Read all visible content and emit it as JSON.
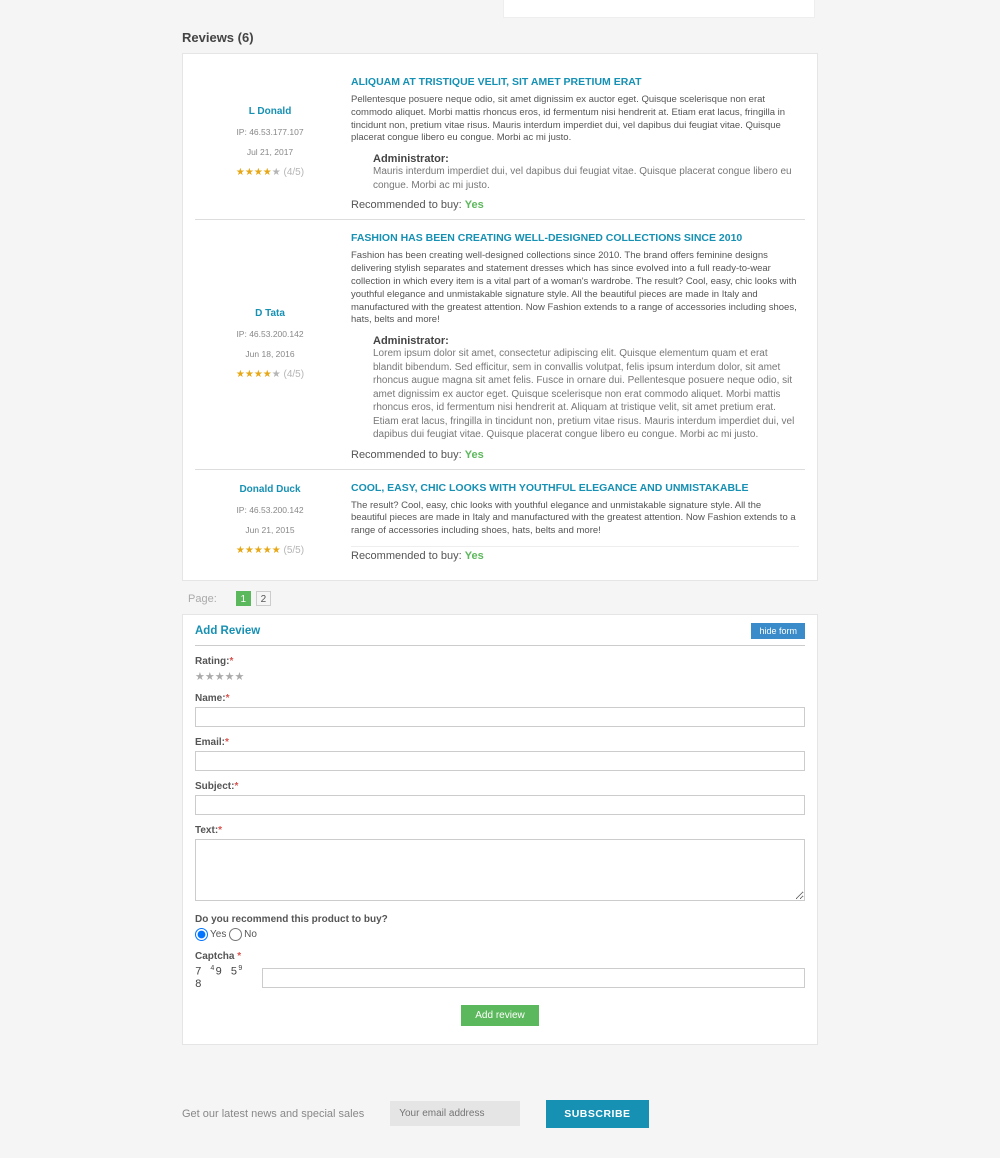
{
  "header": {
    "reviews_title": "Reviews (6)"
  },
  "reviews": [
    {
      "name": "L Donald",
      "ip": "IP: 46.53.177.107",
      "date": "Jul 21, 2017",
      "rating_text": "(4/5)",
      "stars": 4,
      "title": "ALIQUAM AT TRISTIQUE VELIT, SIT AMET PRETIUM ERAT",
      "body": "Pellentesque posuere neque odio, sit amet dignissim ex auctor eget. Quisque scelerisque non erat commodo aliquet. Morbi mattis rhoncus eros, id fermentum nisi hendrerit at. Etiam erat lacus, fringilla in tincidunt non, pretium vitae risus. Mauris interdum imperdiet dui, vel dapibus dui feugiat vitae. Quisque placerat congue libero eu congue. Morbi ac mi justo.",
      "admin": "Administrator:",
      "admin_text": "Mauris interdum imperdiet dui, vel dapibus dui feugiat vitae. Quisque placerat congue libero eu congue. Morbi ac mi justo.",
      "rec_label": "Recommended to buy: ",
      "rec_val": "Yes"
    },
    {
      "name": "D Tata",
      "ip": "IP: 46.53.200.142",
      "date": "Jun 18, 2016",
      "rating_text": "(4/5)",
      "stars": 4,
      "title": "FASHION HAS BEEN CREATING WELL-DESIGNED COLLECTIONS SINCE 2010",
      "body": "Fashion has been creating well-designed collections since 2010. The brand offers feminine designs delivering stylish separates and statement dresses which has since evolved into a full ready-to-wear collection in which every item is a vital part of a woman's wardrobe. The result? Cool, easy, chic looks with youthful elegance and unmistakable signature style. All the beautiful pieces are made in Italy and manufactured with the greatest attention. Now Fashion extends to a range of accessories including shoes, hats, belts and more!",
      "admin": "Administrator:",
      "admin_text": "Lorem ipsum dolor sit amet, consectetur adipiscing elit. Quisque elementum quam et erat blandit bibendum. Sed efficitur, sem in convallis volutpat, felis ipsum interdum dolor, sit amet rhoncus augue magna sit amet felis. Fusce in ornare dui. Pellentesque posuere neque odio, sit amet dignissim ex auctor eget. Quisque scelerisque non erat commodo aliquet. Morbi mattis rhoncus eros, id fermentum nisi hendrerit at. Aliquam at tristique velit, sit amet pretium erat. Etiam erat lacus, fringilla in tincidunt non, pretium vitae risus. Mauris interdum imperdiet dui, vel dapibus dui feugiat vitae. Quisque placerat congue libero eu congue. Morbi ac mi justo.",
      "rec_label": "Recommended to buy: ",
      "rec_val": "Yes"
    },
    {
      "name": "Donald Duck",
      "ip": "IP: 46.53.200.142",
      "date": "Jun 21, 2015",
      "rating_text": "(5/5)",
      "stars": 5,
      "title": "COOL, EASY, CHIC LOOKS WITH YOUTHFUL ELEGANCE AND UNMISTAKABLE",
      "body": "The result? Cool, easy, chic looks with youthful elegance and unmistakable signature style. All the beautiful pieces are made in Italy and manufactured with the greatest attention. Now Fashion extends to a range of accessories including shoes, hats, belts and more!",
      "admin": "",
      "admin_text": "",
      "rec_label": "Recommended to buy: ",
      "rec_val": "Yes"
    }
  ],
  "pager": {
    "label": "Page:",
    "p1": "1",
    "p2": "2"
  },
  "form": {
    "title": "Add Review",
    "hide": "hide form",
    "rating": "Rating:",
    "name": "Name:",
    "email": "Email:",
    "subject": "Subject:",
    "text": "Text:",
    "recommend_q": "Do you recommend this product to buy?",
    "yes": "Yes",
    "no": "No",
    "captcha": "Captcha ",
    "captcha_code": "7 49 59 8",
    "submit": "Add review"
  },
  "footer": {
    "text": "Get our latest news and special sales",
    "placeholder": "Your email address",
    "button": "SUBSCRIBE"
  }
}
